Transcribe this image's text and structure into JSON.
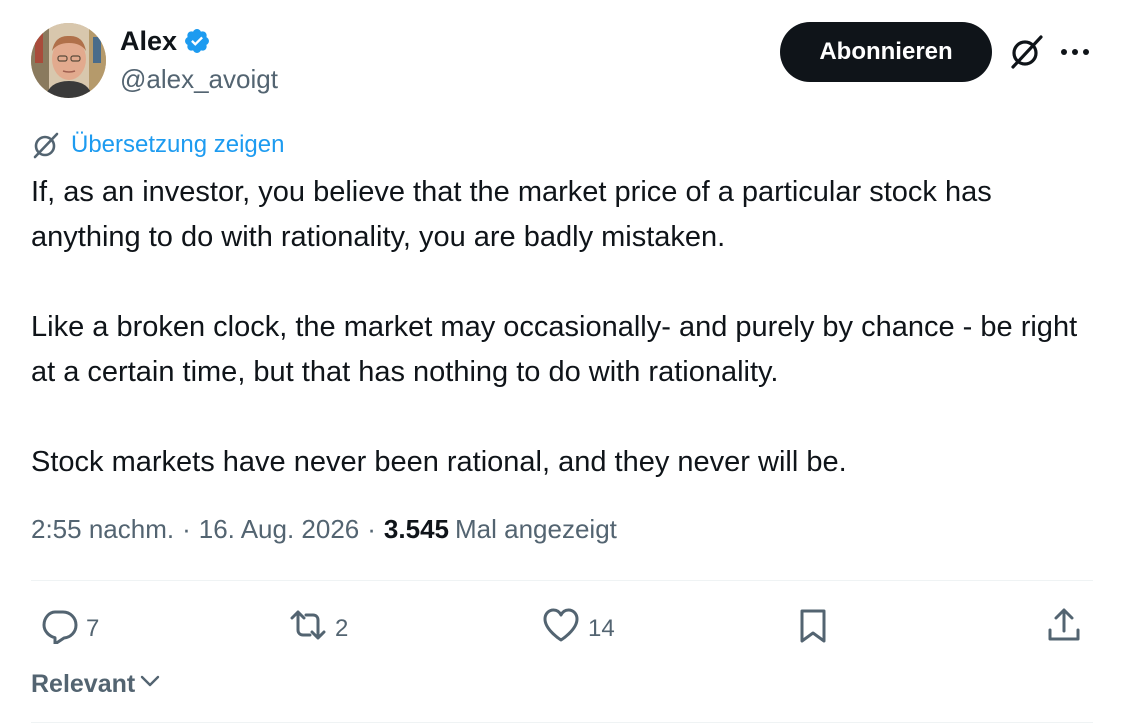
{
  "author": {
    "name": "Alex",
    "handle": "@alex_avoigt",
    "verified": true
  },
  "follow_button": {
    "label": "Abonnieren"
  },
  "translate": {
    "label": "Übersetzung zeigen"
  },
  "tweet": {
    "paragraphs": [
      "If, as an investor, you believe that the market price of a particular stock has anything to do with rationality, you are badly mistaken.",
      "Like a broken clock, the market may occasionally- and purely by chance - be right at a certain time, but that has nothing to do with rationality.",
      "Stock markets have never been rational, and they never will be."
    ]
  },
  "meta": {
    "time": "2:55 nachm.",
    "separator": "·",
    "date": "16. Aug. 2026",
    "views_count": "3.545",
    "views_label": "Mal angezeigt"
  },
  "actions": {
    "replies": "7",
    "reposts": "2",
    "likes": "14"
  },
  "sort": {
    "label": "Relevant"
  },
  "colors": {
    "text": "#0f1419",
    "secondary": "#536471",
    "accent": "#1d9bf0",
    "button_bg": "#0f1419",
    "divider": "#eff3f4"
  },
  "icons": [
    "verified-badge-icon",
    "grok-icon",
    "more-icon",
    "translate-icon",
    "reply-icon",
    "repost-icon",
    "like-icon",
    "bookmark-icon",
    "share-icon",
    "chevron-down-icon"
  ]
}
